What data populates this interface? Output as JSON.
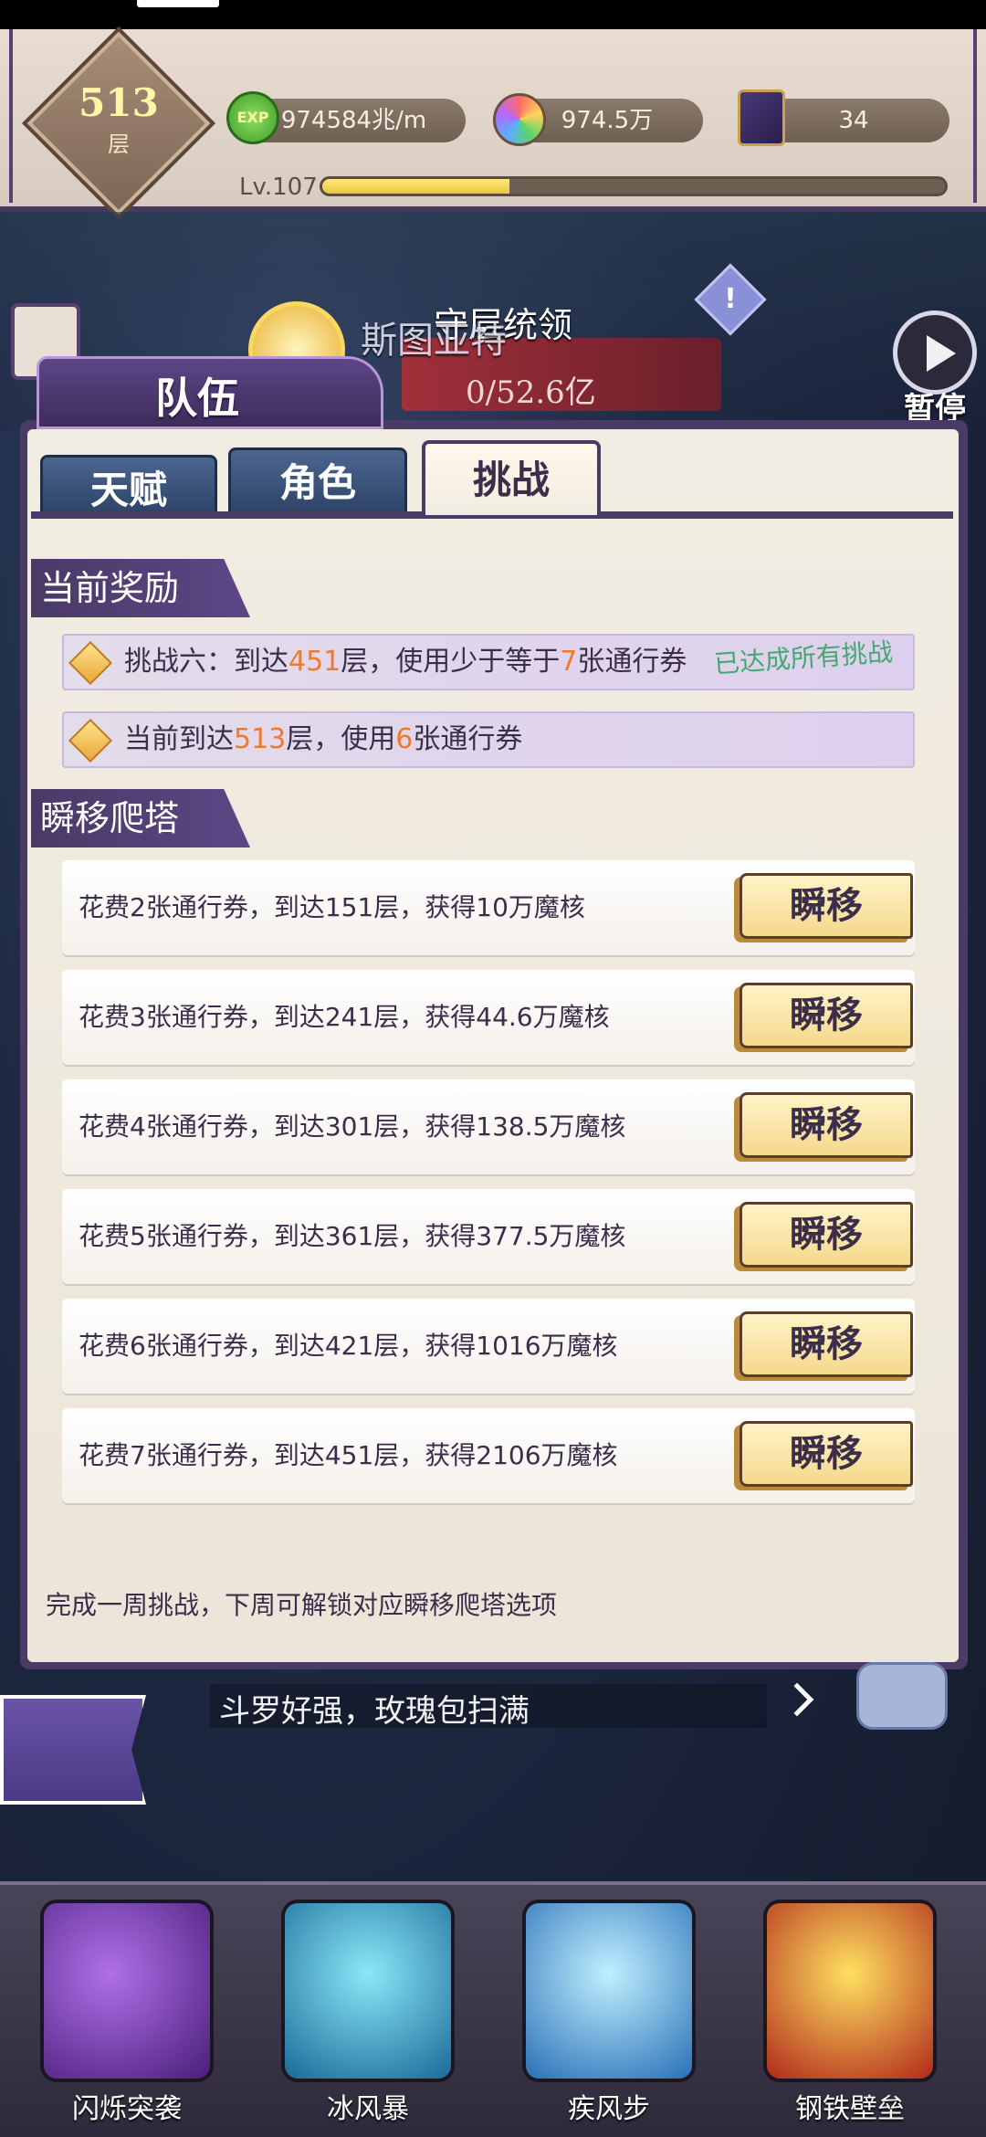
{
  "hud": {
    "floor_number": "513",
    "floor_unit": "层",
    "exp_icon_label": "EXP",
    "exp_value": "974584兆/m",
    "gem_value": "974.5万",
    "card_value": "34",
    "level_label": "Lv.107",
    "level_progress": 0.3,
    "icons": [
      "exp-icon",
      "gem-icon",
      "card-icon"
    ]
  },
  "scene": {
    "boss_title": "守层统领",
    "boss_name": "斯图亚特",
    "boss_hp": "0/52.6亿",
    "pause_label": "暂停",
    "icons": [
      "calendar-icon",
      "warning-icon",
      "play-icon"
    ]
  },
  "panel": {
    "title": "队伍",
    "tabs": [
      {
        "label": "天赋",
        "active": false
      },
      {
        "label": "角色",
        "active": false
      },
      {
        "label": "挑战",
        "active": true
      }
    ],
    "reward_section": {
      "title": "当前奖励",
      "rows": [
        {
          "prefix": "挑战六：到达",
          "floor": "451",
          "mid": "层，使用少于等于",
          "count": "7",
          "suffix": "张通行券",
          "note": "已达成所有挑战"
        },
        {
          "prefix": "当前到达",
          "floor": "513",
          "mid": "层，使用",
          "count": "6",
          "suffix": "张通行券"
        }
      ]
    },
    "teleport_section": {
      "title": "瞬移爬塔",
      "button_label": "瞬移",
      "rows": [
        {
          "text": "花费2张通行券，到达151层，获得10万魔核"
        },
        {
          "text": "花费3张通行券，到达241层，获得44.6万魔核"
        },
        {
          "text": "花费4张通行券，到达301层，获得138.5万魔核"
        },
        {
          "text": "花费5张通行券，到达361层，获得377.5万魔核"
        },
        {
          "text": "花费6张通行券，到达421层，获得1016万魔核"
        },
        {
          "text": "花费7张通行券，到达451层，获得2106万魔核"
        }
      ]
    },
    "footnote": "完成一周挑战，下周可解锁对应瞬移爬塔选项"
  },
  "chat": {
    "text": "斗罗好强，玫瑰包扫满"
  },
  "skills": [
    {
      "label": "闪烁突袭"
    },
    {
      "label": "冰风暴"
    },
    {
      "label": "疾风步"
    },
    {
      "label": "钢铁壁垒"
    }
  ],
  "colors": {
    "accent_purple": "#4a3a66",
    "highlight_orange": "#f07a2a",
    "done_green": "#46a870",
    "exp_bar": "#e8c83a"
  }
}
